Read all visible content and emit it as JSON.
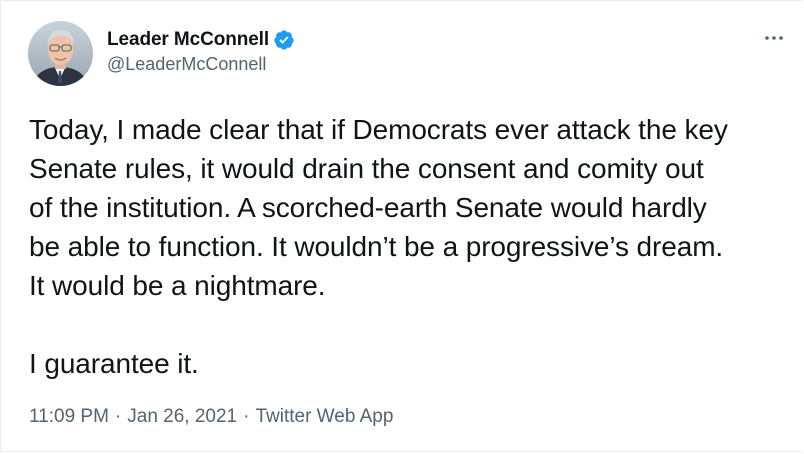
{
  "author": {
    "display_name": "Leader McConnell",
    "handle": "@LeaderMcConnell",
    "verified": true,
    "avatar_icon": "profile-photo",
    "verified_icon": "verified-badge-icon",
    "verified_color": "#1d9bf0"
  },
  "menu": {
    "more_icon": "more-options-icon"
  },
  "tweet": {
    "lines": [
      "Today, I made clear that if Democrats ever attack the key",
      "Senate rules, it would drain the consent and comity out",
      "of the institution. A scorched-earth Senate would hardly",
      "be able to function. It wouldn’t be a progressive’s dream.",
      "It would be a nightmare."
    ],
    "closing": "I guarantee it."
  },
  "meta": {
    "time": "11:09 PM",
    "separator": "·",
    "date": "Jan 26, 2021",
    "source": "Twitter Web App"
  },
  "colors": {
    "text": "#0f1419",
    "secondary": "#536471",
    "border": "#e6ecf0"
  }
}
